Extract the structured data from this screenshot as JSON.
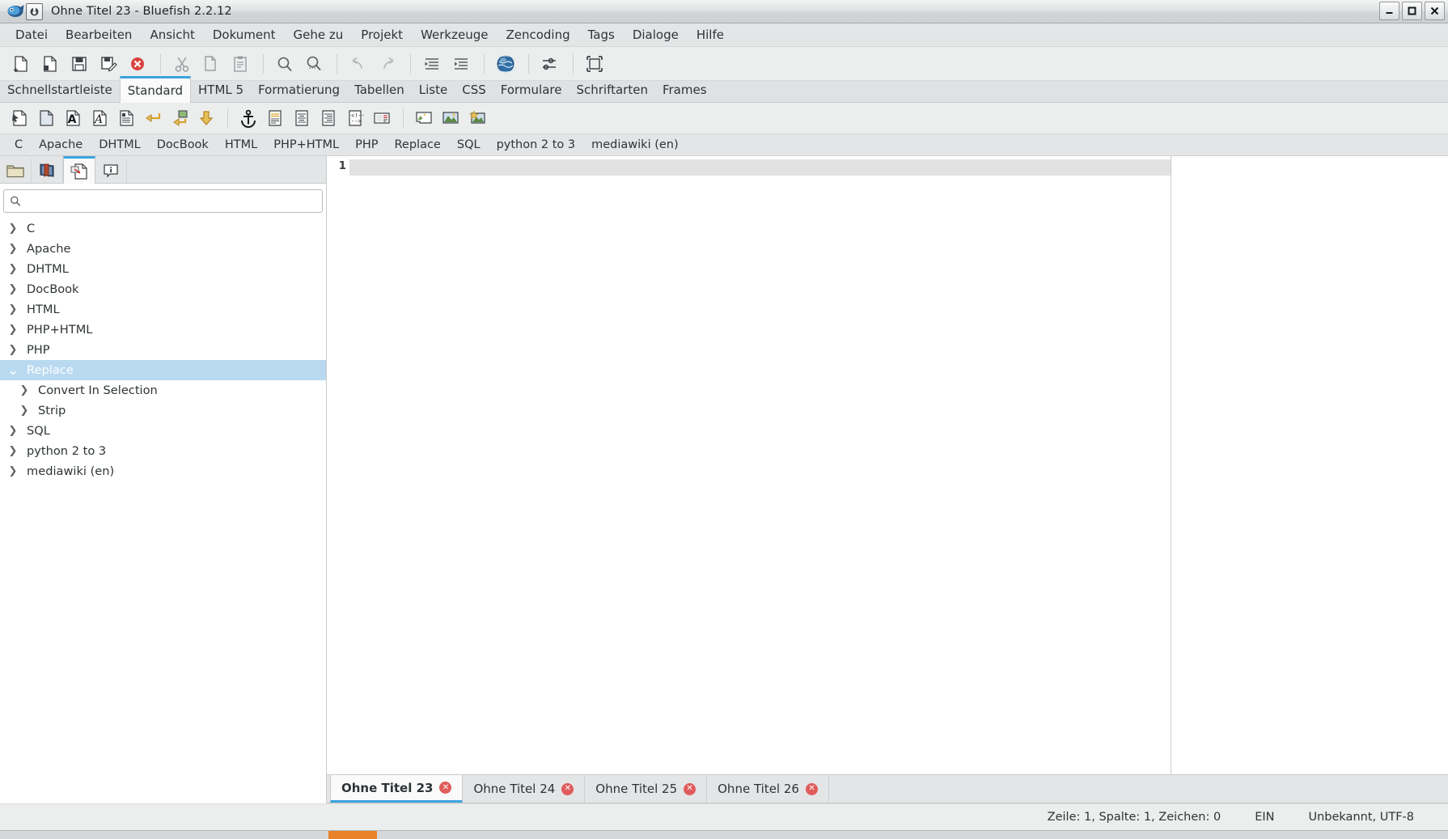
{
  "window": {
    "title": "Ohne Titel 23 - Bluefish 2.2.12",
    "app_icon": "bluefish-icon",
    "doc_icon": "document-icon",
    "controls": {
      "minimize": "–",
      "maximize": "☐",
      "close": "✕"
    }
  },
  "menubar": {
    "items": [
      {
        "label": "Datei"
      },
      {
        "label": "Bearbeiten"
      },
      {
        "label": "Ansicht"
      },
      {
        "label": "Dokument"
      },
      {
        "label": "Gehe zu"
      },
      {
        "label": "Projekt"
      },
      {
        "label": "Werkzeuge"
      },
      {
        "label": "Zencoding"
      },
      {
        "label": "Tags"
      },
      {
        "label": "Dialoge"
      },
      {
        "label": "Hilfe"
      }
    ]
  },
  "main_toolbar": {
    "buttons": [
      {
        "name": "new-document-icon",
        "title": "Neu"
      },
      {
        "name": "open-document-icon",
        "title": "Öffnen"
      },
      {
        "name": "save-icon",
        "title": "Speichern"
      },
      {
        "name": "save-as-icon",
        "title": "Speichern unter"
      },
      {
        "name": "close-document-icon",
        "title": "Schließen"
      },
      {
        "name": "cut-icon",
        "title": "Ausschneiden"
      },
      {
        "name": "copy-icon",
        "title": "Kopieren"
      },
      {
        "name": "paste-icon",
        "title": "Einfügen"
      },
      {
        "name": "find-icon",
        "title": "Suchen"
      },
      {
        "name": "find-replace-icon",
        "title": "Suchen und Ersetzen"
      },
      {
        "name": "undo-icon",
        "title": "Rückgängig"
      },
      {
        "name": "redo-icon",
        "title": "Wiederholen"
      },
      {
        "name": "unindent-icon",
        "title": "Einzug verkleinern"
      },
      {
        "name": "indent-icon",
        "title": "Einzug vergrößern"
      },
      {
        "name": "preview-browser-icon",
        "title": "Vorschau im Browser"
      },
      {
        "name": "preferences-icon",
        "title": "Einstellungen"
      },
      {
        "name": "fullscreen-icon",
        "title": "Vollbild"
      }
    ]
  },
  "toolbar_tabs": {
    "items": [
      {
        "label": "Schnellstartleiste",
        "active": false
      },
      {
        "label": "Standard",
        "active": true
      },
      {
        "label": "HTML 5",
        "active": false
      },
      {
        "label": "Formatierung",
        "active": false
      },
      {
        "label": "Tabellen",
        "active": false
      },
      {
        "label": "Liste",
        "active": false
      },
      {
        "label": "CSS",
        "active": false
      },
      {
        "label": "Formulare",
        "active": false
      },
      {
        "label": "Schriftarten",
        "active": false
      },
      {
        "label": "Frames",
        "active": false
      }
    ]
  },
  "html_toolbar": {
    "buttons": [
      {
        "name": "quickstart-icon",
        "title": "Schnellstart"
      },
      {
        "name": "body-icon",
        "title": "Body"
      },
      {
        "name": "bold-icon",
        "title": "Fett"
      },
      {
        "name": "italic-icon",
        "title": "Kursiv"
      },
      {
        "name": "paragraph-icon",
        "title": "Absatz"
      },
      {
        "name": "linebreak-icon",
        "title": "Zeilenumbruch"
      },
      {
        "name": "break-clear-icon",
        "title": "Umbruch und Bild löschen"
      },
      {
        "name": "non-breaking-space-icon",
        "title": "Geschütztes Leerzeichen"
      },
      {
        "name": "anchor-icon",
        "title": "Anker"
      },
      {
        "name": "align-left-icon",
        "title": "Linksbündig"
      },
      {
        "name": "align-center-icon",
        "title": "Zentriert"
      },
      {
        "name": "align-right-icon",
        "title": "Rechtsbündig"
      },
      {
        "name": "comment-icon",
        "title": "Kommentar"
      },
      {
        "name": "email-icon",
        "title": "E-Mail"
      },
      {
        "name": "image-icon",
        "title": "Bild einfügen"
      },
      {
        "name": "thumbnail-icon",
        "title": "Vorschaubild"
      },
      {
        "name": "multi-thumbnail-icon",
        "title": "Mehrere Vorschaubilder"
      }
    ]
  },
  "snippet_tabs": {
    "items": [
      {
        "label": "C"
      },
      {
        "label": "Apache"
      },
      {
        "label": "DHTML"
      },
      {
        "label": "DocBook"
      },
      {
        "label": "HTML"
      },
      {
        "label": "PHP+HTML"
      },
      {
        "label": "PHP"
      },
      {
        "label": "Replace"
      },
      {
        "label": "SQL"
      },
      {
        "label": "python 2 to 3"
      },
      {
        "label": "mediawiki (en)"
      }
    ]
  },
  "sidebar": {
    "tabs": [
      {
        "name": "file-browser-tab",
        "icon": "folder-icon",
        "active": false
      },
      {
        "name": "bookmarks-tab",
        "icon": "book-icon",
        "active": false
      },
      {
        "name": "snippets-tab",
        "icon": "snippet-insert-icon",
        "active": true
      },
      {
        "name": "reference-tab",
        "icon": "info-icon",
        "active": false
      }
    ],
    "search": {
      "placeholder": "",
      "value": "",
      "icon": "search-icon"
    },
    "tree": [
      {
        "label": "C",
        "expanded": false,
        "level": 0,
        "selected": false
      },
      {
        "label": "Apache",
        "expanded": false,
        "level": 0,
        "selected": false
      },
      {
        "label": "DHTML",
        "expanded": false,
        "level": 0,
        "selected": false
      },
      {
        "label": "DocBook",
        "expanded": false,
        "level": 0,
        "selected": false
      },
      {
        "label": "HTML",
        "expanded": false,
        "level": 0,
        "selected": false
      },
      {
        "label": "PHP+HTML",
        "expanded": false,
        "level": 0,
        "selected": false
      },
      {
        "label": "PHP",
        "expanded": false,
        "level": 0,
        "selected": false
      },
      {
        "label": "Replace",
        "expanded": true,
        "level": 0,
        "selected": true
      },
      {
        "label": "Convert In Selection",
        "expanded": false,
        "level": 1,
        "selected": false
      },
      {
        "label": "Strip",
        "expanded": false,
        "level": 1,
        "selected": false
      },
      {
        "label": "SQL",
        "expanded": false,
        "level": 0,
        "selected": false
      },
      {
        "label": "python 2 to 3",
        "expanded": false,
        "level": 0,
        "selected": false
      },
      {
        "label": "mediawiki (en)",
        "expanded": false,
        "level": 0,
        "selected": false
      }
    ]
  },
  "editor": {
    "line_numbers": [
      "1"
    ],
    "content": ""
  },
  "document_tabs": {
    "items": [
      {
        "label": "Ohne Titel 23",
        "active": true
      },
      {
        "label": "Ohne Titel 24",
        "active": false
      },
      {
        "label": "Ohne Titel 25",
        "active": false
      },
      {
        "label": "Ohne Titel 26",
        "active": false
      }
    ],
    "close_glyph": "✕"
  },
  "statusbar": {
    "position": "Zeile: 1, Spalte: 1, Zeichen: 0",
    "insert_mode": "EIN",
    "encoding": "Unbekannt, UTF-8"
  },
  "colors": {
    "accent": "#3ea3e0",
    "selection": "#b8d9f0",
    "close_red": "#e05c5c",
    "chrome": "#e4e5e6"
  }
}
